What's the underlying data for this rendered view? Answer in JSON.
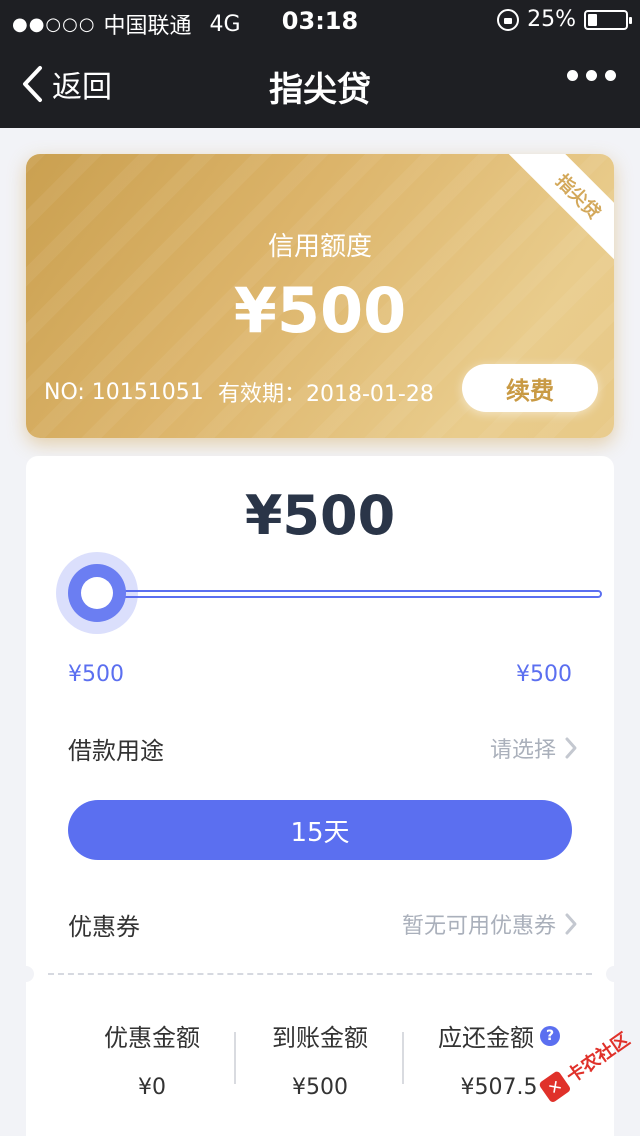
{
  "status_bar": {
    "signal": "●●○○○",
    "carrier": "中国联通",
    "network": "4G",
    "time": "03:18",
    "battery_percent": "25%",
    "battery_level": 0.25
  },
  "nav": {
    "back_label": "返回",
    "title": "指尖贷"
  },
  "card": {
    "corner_tag": "指尖贷",
    "credit_label": "信用额度",
    "credit_amount": "¥500",
    "number": "NO: 10151051",
    "validity": "有效期：2018-01-28",
    "renew_label": "续费"
  },
  "loan": {
    "amount": "¥500",
    "slider_min": "¥500",
    "slider_max": "¥500",
    "slider_level": 0,
    "purpose_label": "借款用途",
    "purpose_value": "请选择",
    "term_label": "15天",
    "coupon_label": "优惠券",
    "coupon_value": "暂无可用优惠券"
  },
  "summary": {
    "discount_label": "优惠金额",
    "discount_value": "¥0",
    "received_label": "到账金额",
    "received_value": "¥500",
    "repay_label": "应还金额",
    "repay_value": "¥507.5"
  },
  "watermark": {
    "text": "卡农社区"
  },
  "colors": {
    "accent": "#5b6ff0",
    "gold": "#dcb46a",
    "dark_bar": "#1e1f23"
  }
}
